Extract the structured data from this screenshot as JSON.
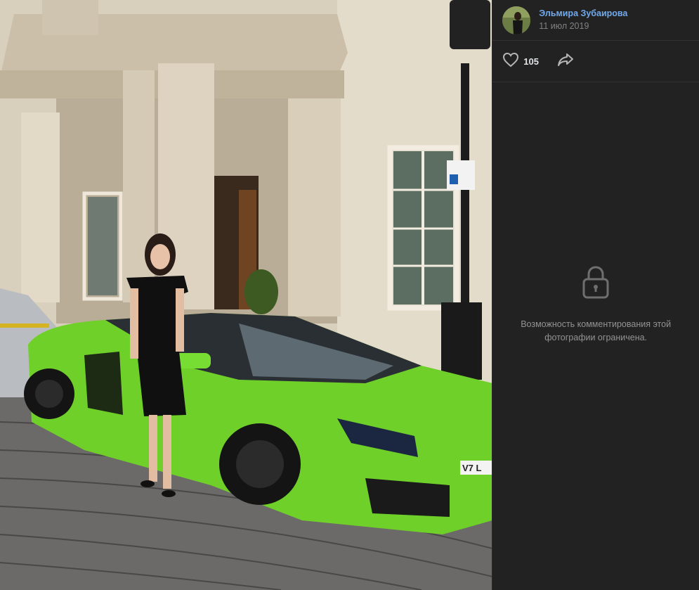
{
  "author": {
    "name": "Эльмира Зубаирова",
    "date": "11 июл 2019"
  },
  "actions": {
    "likes": "105",
    "like_icon": "heart-icon",
    "share_icon": "share-arrow-icon"
  },
  "comments": {
    "lock_icon": "lock-icon",
    "restricted_message": "Возможность комментирования этой фотографии ограничена."
  },
  "photo": {
    "plate_text": "V7 L"
  },
  "colors": {
    "panel_bg": "#222222",
    "author_link": "#71aaeb",
    "muted_text": "#828282",
    "car_green": "#6fd02a"
  }
}
